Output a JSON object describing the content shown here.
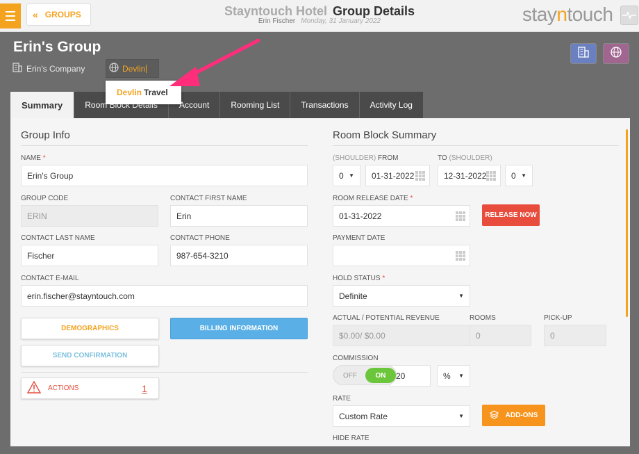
{
  "header": {
    "groups_label": "GROUPS",
    "hotel_name": "Stayntouch Hotel",
    "page_title": "Group Details",
    "user": "Erin Fischer",
    "date": "Monday, 31 January 2022",
    "brand_pre": "stay",
    "brand_n": "n",
    "brand_post": "touch"
  },
  "group": {
    "name": "Erin's Group",
    "company": "Erin's Company",
    "travel_agent_input": "Devlin",
    "suggestion_match": "Devlin",
    "suggestion_rest": "Travel"
  },
  "tabs": [
    "Summary",
    "Room Block Details",
    "Account",
    "Rooming List",
    "Transactions",
    "Activity Log"
  ],
  "group_info": {
    "title": "Group Info",
    "name_label": "NAME",
    "name_value": "Erin's Group",
    "group_code_label": "GROUP CODE",
    "group_code_value": "ERIN",
    "contact_first_label": "CONTACT FIRST NAME",
    "contact_first_value": "Erin",
    "contact_last_label": "CONTACT LAST NAME",
    "contact_last_value": "Fischer",
    "contact_phone_label": "CONTACT PHONE",
    "contact_phone_value": "987-654-3210",
    "contact_email_label": "CONTACT E-MAIL",
    "contact_email_value": "erin.fischer@stayntouch.com",
    "demographics_label": "DEMOGRAPHICS",
    "billing_label": "BILLING INFORMATION",
    "send_confirmation_label": "SEND CONFIRMATION",
    "actions_label": "ACTIONS",
    "actions_count": "1"
  },
  "room_block": {
    "title": "Room Block Summary",
    "shoulder_from_pre": "(SHOULDER)",
    "shoulder_from_post": "FROM",
    "to_pre": "TO",
    "to_post": "(SHOULDER)",
    "shoulder_from_value": "0",
    "from_date": "01-31-2022",
    "to_date": "12-31-2022",
    "shoulder_to_value": "0",
    "release_date_label": "ROOM RELEASE DATE",
    "release_date_value": "01-31-2022",
    "release_now_label": "RELEASE NOW",
    "payment_date_label": "PAYMENT DATE",
    "payment_date_value": "",
    "hold_status_label": "HOLD STATUS",
    "hold_status_value": "Definite",
    "revenue_label": "ACTUAL / POTENTIAL REVENUE",
    "revenue_value": "$0.00/ $0.00",
    "rooms_label": "ROOMS",
    "rooms_value": "0",
    "pickup_label": "PICK-UP",
    "pickup_value": "0",
    "commission_label": "COMMISSION",
    "toggle_off": "OFF",
    "toggle_on": "ON",
    "commission_value": "20",
    "commission_unit": "%",
    "rate_label": "RATE",
    "rate_value": "Custom Rate",
    "addons_label": "ADD-ONS",
    "hide_rate_label": "HIDE RATE"
  },
  "colors": {
    "accent": "#f4a31f",
    "arrow": "#ff2d7a",
    "billing_button": "#5ab0e6",
    "release_button": "#e74c3c",
    "toggle_on": "#6cc63b"
  }
}
